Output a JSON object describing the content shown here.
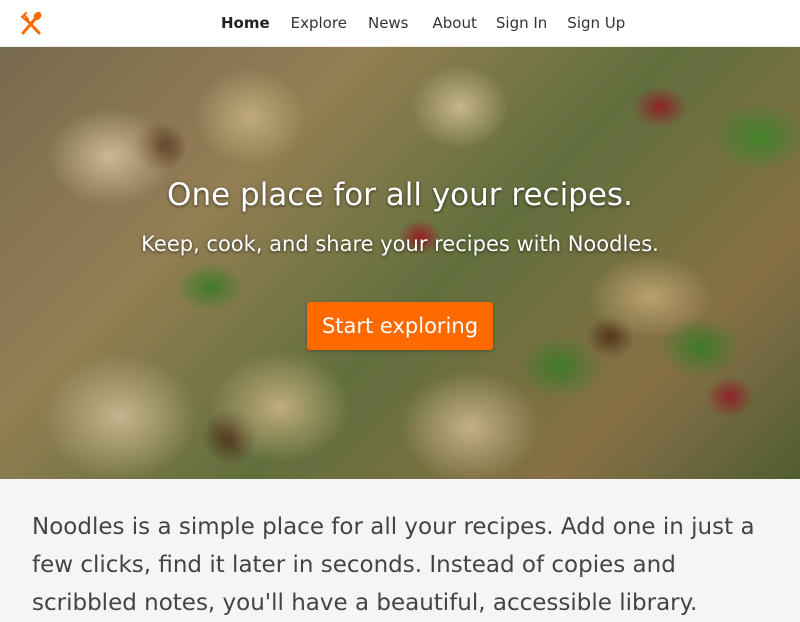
{
  "brand": {
    "logo_icon": "fork-spoon-icon",
    "accent_color": "#ff6a00"
  },
  "nav": {
    "items": [
      {
        "label": "Home",
        "active": true
      },
      {
        "label": "Explore",
        "active": false
      },
      {
        "label": "News",
        "active": false
      },
      {
        "label": "About",
        "active": false
      },
      {
        "label": "Sign In",
        "active": false
      },
      {
        "label": "Sign Up",
        "active": false
      }
    ]
  },
  "hero": {
    "title": "One place for all your recipes.",
    "subtitle": "Keep, cook, and share your recipes with Noodles.",
    "cta_label": "Start exploring",
    "background_image": "roasted-cauliflower-salad"
  },
  "about": {
    "text": "Noodles is a simple place for all your recipes. Add one in just a few clicks, find it later in seconds. Instead of copies and scribbled notes, you'll have a beautiful, accessible library."
  }
}
